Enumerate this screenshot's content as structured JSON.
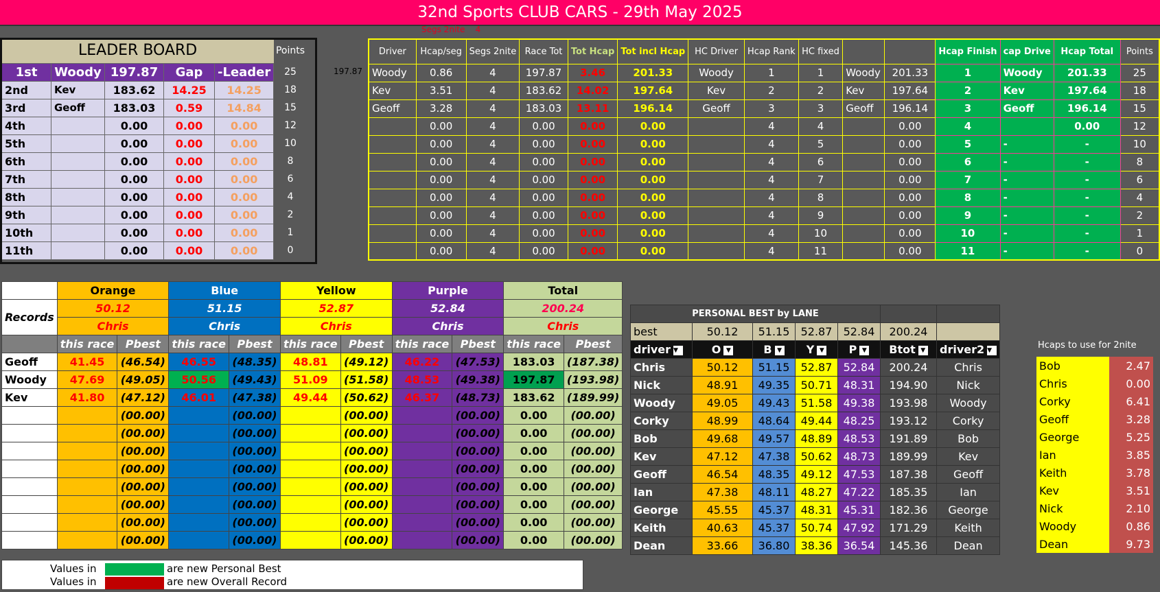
{
  "title": "32nd Sports CLUB CARS - 29th May 2025",
  "segs_label": "Segs 2nite",
  "segs_value": "4",
  "leaderboard": {
    "title": "LEADER BOARD",
    "points_header": "Points",
    "header_pos": "1st",
    "header_driver": "Woody",
    "header_total": "197.87",
    "header_gap": "Gap",
    "header_leader": "-Leader",
    "side_value": "197.87",
    "rows": [
      {
        "pos": "2nd",
        "driver": "Kev",
        "total": "183.62",
        "gap": "14.25",
        "leader": "14.25"
      },
      {
        "pos": "3rd",
        "driver": "Geoff",
        "total": "183.03",
        "gap": "0.59",
        "leader": "14.84"
      },
      {
        "pos": "4th",
        "driver": "",
        "total": "0.00",
        "gap": "0.00",
        "leader": "0.00"
      },
      {
        "pos": "5th",
        "driver": "",
        "total": "0.00",
        "gap": "0.00",
        "leader": "0.00"
      },
      {
        "pos": "6th",
        "driver": "",
        "total": "0.00",
        "gap": "0.00",
        "leader": "0.00"
      },
      {
        "pos": "7th",
        "driver": "",
        "total": "0.00",
        "gap": "0.00",
        "leader": "0.00"
      },
      {
        "pos": "8th",
        "driver": "",
        "total": "0.00",
        "gap": "0.00",
        "leader": "0.00"
      },
      {
        "pos": "9th",
        "driver": "",
        "total": "0.00",
        "gap": "0.00",
        "leader": "0.00"
      },
      {
        "pos": "10th",
        "driver": "",
        "total": "0.00",
        "gap": "0.00",
        "leader": "0.00"
      },
      {
        "pos": "11th",
        "driver": "",
        "total": "0.00",
        "gap": "0.00",
        "leader": "0.00"
      }
    ],
    "points": [
      "25",
      "18",
      "15",
      "12",
      "10",
      "8",
      "6",
      "4",
      "2",
      "1",
      "0"
    ]
  },
  "handicap": {
    "headers": [
      "Driver",
      "Hcap/seg",
      "Segs 2nite",
      "Race Tot",
      "Tot Hcap",
      "Tot incl Hcap",
      "HC Driver",
      "Hcap Rank",
      "HC fixed",
      "",
      "",
      "Hcap Finish",
      "cap Drive",
      "Hcap Total",
      "Points"
    ],
    "rows": [
      [
        "Woody",
        "0.86",
        "4",
        "197.87",
        "3.46",
        "201.33",
        "Woody",
        "1",
        "1",
        "Woody",
        "201.33",
        "1",
        "Woody",
        "201.33",
        "25"
      ],
      [
        "Kev",
        "3.51",
        "4",
        "183.62",
        "14.02",
        "197.64",
        "Kev",
        "2",
        "2",
        "Kev",
        "197.64",
        "2",
        "Kev",
        "197.64",
        "18"
      ],
      [
        "Geoff",
        "3.28",
        "4",
        "183.03",
        "13.11",
        "196.14",
        "Geoff",
        "3",
        "3",
        "Geoff",
        "196.14",
        "3",
        "Geoff",
        "196.14",
        "15"
      ],
      [
        "",
        "0.00",
        "4",
        "0.00",
        "0.00",
        "0.00",
        "",
        "4",
        "4",
        "",
        "0.00",
        "4",
        "",
        "0.00",
        "12"
      ],
      [
        "",
        "0.00",
        "4",
        "0.00",
        "0.00",
        "0.00",
        "",
        "4",
        "5",
        "",
        "0.00",
        "5",
        "-",
        "-",
        "10"
      ],
      [
        "",
        "0.00",
        "4",
        "0.00",
        "0.00",
        "0.00",
        "",
        "4",
        "6",
        "",
        "0.00",
        "6",
        "-",
        "-",
        "8"
      ],
      [
        "",
        "0.00",
        "4",
        "0.00",
        "0.00",
        "0.00",
        "",
        "4",
        "7",
        "",
        "0.00",
        "7",
        "-",
        "-",
        "6"
      ],
      [
        "",
        "0.00",
        "4",
        "0.00",
        "0.00",
        "0.00",
        "",
        "4",
        "8",
        "",
        "0.00",
        "8",
        "-",
        "-",
        "4"
      ],
      [
        "",
        "0.00",
        "4",
        "0.00",
        "0.00",
        "0.00",
        "",
        "4",
        "9",
        "",
        "0.00",
        "9",
        "-",
        "-",
        "2"
      ],
      [
        "",
        "0.00",
        "4",
        "0.00",
        "0.00",
        "0.00",
        "",
        "4",
        "10",
        "",
        "0.00",
        "10",
        "-",
        "-",
        "1"
      ],
      [
        "",
        "0.00",
        "4",
        "0.00",
        "0.00",
        "0.00",
        "",
        "4",
        "11",
        "",
        "0.00",
        "11",
        "-",
        "-",
        "0"
      ]
    ]
  },
  "records": {
    "lanes": [
      "Orange",
      "Blue",
      "Yellow",
      "Purple",
      "Total"
    ],
    "records_label": "Records",
    "record_values": [
      "50.12",
      "51.15",
      "52.87",
      "52.84",
      "200.24"
    ],
    "record_holders": [
      "Chris",
      "Chris",
      "Chris",
      "Chris",
      "Chris"
    ],
    "sub_headers": [
      "this race",
      "Pbest",
      "this race",
      "Pbest",
      "this race",
      "Pbest",
      "this race",
      "Pbest",
      "this race",
      "Pbest"
    ],
    "rows": [
      {
        "driver": "Geoff",
        "cells": [
          "41.45",
          "(46.54)",
          "46.55",
          "(48.35)",
          "48.81",
          "(49.12)",
          "46.22",
          "(47.53)",
          "183.03",
          "(187.38)"
        ]
      },
      {
        "driver": "Woody",
        "cells": [
          "47.69",
          "(49.05)",
          "50.56",
          "(49.43)",
          "51.09",
          "(51.58)",
          "48.53",
          "(49.38)",
          "197.87",
          "(193.98)"
        ]
      },
      {
        "driver": "Kev",
        "cells": [
          "41.80",
          "(47.12)",
          "46.01",
          "(47.38)",
          "49.44",
          "(50.62)",
          "46.37",
          "(48.73)",
          "183.62",
          "(189.99)"
        ]
      },
      {
        "driver": "",
        "cells": [
          "",
          "(00.00)",
          "",
          "(00.00)",
          "",
          "(00.00)",
          "",
          "(00.00)",
          "0.00",
          "(00.00)"
        ]
      },
      {
        "driver": "",
        "cells": [
          "",
          "(00.00)",
          "",
          "(00.00)",
          "",
          "(00.00)",
          "",
          "(00.00)",
          "0.00",
          "(00.00)"
        ]
      },
      {
        "driver": "",
        "cells": [
          "",
          "(00.00)",
          "",
          "(00.00)",
          "",
          "(00.00)",
          "",
          "(00.00)",
          "0.00",
          "(00.00)"
        ]
      },
      {
        "driver": "",
        "cells": [
          "",
          "(00.00)",
          "",
          "(00.00)",
          "",
          "(00.00)",
          "",
          "(00.00)",
          "0.00",
          "(00.00)"
        ]
      },
      {
        "driver": "",
        "cells": [
          "",
          "(00.00)",
          "",
          "(00.00)",
          "",
          "(00.00)",
          "",
          "(00.00)",
          "0.00",
          "(00.00)"
        ]
      },
      {
        "driver": "",
        "cells": [
          "",
          "(00.00)",
          "",
          "(00.00)",
          "",
          "(00.00)",
          "",
          "(00.00)",
          "0.00",
          "(00.00)"
        ]
      },
      {
        "driver": "",
        "cells": [
          "",
          "(00.00)",
          "",
          "(00.00)",
          "",
          "(00.00)",
          "",
          "(00.00)",
          "0.00",
          "(00.00)"
        ]
      },
      {
        "driver": "",
        "cells": [
          "",
          "(00.00)",
          "",
          "(00.00)",
          "",
          "(00.00)",
          "",
          "(00.00)",
          "0.00",
          "(00.00)"
        ]
      }
    ],
    "legend_values_in": "Values in",
    "legend_green": "are new Personal Best",
    "legend_red": "are new Overall Record"
  },
  "personal_best": {
    "title": "PERSONAL BEST by LANE",
    "best_label": "best",
    "best_values": [
      "50.12",
      "51.15",
      "52.87",
      "52.84",
      "200.24"
    ],
    "headers": [
      "driver",
      "O",
      "B",
      "Y",
      "P",
      "Btot",
      "driver2"
    ],
    "rows": [
      [
        "Chris",
        "50.12",
        "51.15",
        "52.87",
        "52.84",
        "200.24",
        "Chris"
      ],
      [
        "Nick",
        "48.91",
        "49.35",
        "50.71",
        "48.31",
        "194.90",
        "Nick"
      ],
      [
        "Woody",
        "49.05",
        "49.43",
        "51.58",
        "49.38",
        "193.98",
        "Woody"
      ],
      [
        "Corky",
        "48.99",
        "48.64",
        "49.44",
        "48.25",
        "193.12",
        "Corky"
      ],
      [
        "Bob",
        "49.68",
        "49.57",
        "48.89",
        "48.53",
        "191.89",
        "Bob"
      ],
      [
        "Kev",
        "47.12",
        "47.38",
        "50.62",
        "48.73",
        "189.99",
        "Kev"
      ],
      [
        "Geoff",
        "46.54",
        "48.35",
        "49.12",
        "47.53",
        "187.38",
        "Geoff"
      ],
      [
        "Ian",
        "47.38",
        "48.11",
        "48.27",
        "47.22",
        "185.35",
        "Ian"
      ],
      [
        "George",
        "45.55",
        "45.37",
        "48.31",
        "45.31",
        "182.36",
        "George"
      ],
      [
        "Keith",
        "40.63",
        "45.37",
        "50.74",
        "47.92",
        "171.29",
        "Keith"
      ],
      [
        "Dean",
        "33.66",
        "36.80",
        "38.36",
        "36.54",
        "145.36",
        "Dean"
      ]
    ]
  },
  "hcaps": {
    "label": "Hcaps to use for 2nite",
    "rows": [
      [
        "Bob",
        "2.47"
      ],
      [
        "Chris",
        "0.00"
      ],
      [
        "Corky",
        "6.41"
      ],
      [
        "Geoff",
        "3.28"
      ],
      [
        "George",
        "5.25"
      ],
      [
        "Ian",
        "3.85"
      ],
      [
        "Keith",
        "3.78"
      ],
      [
        "Kev",
        "3.51"
      ],
      [
        "Nick",
        "2.10"
      ],
      [
        "Woody",
        "0.86"
      ],
      [
        "Dean",
        "9.73"
      ]
    ]
  }
}
